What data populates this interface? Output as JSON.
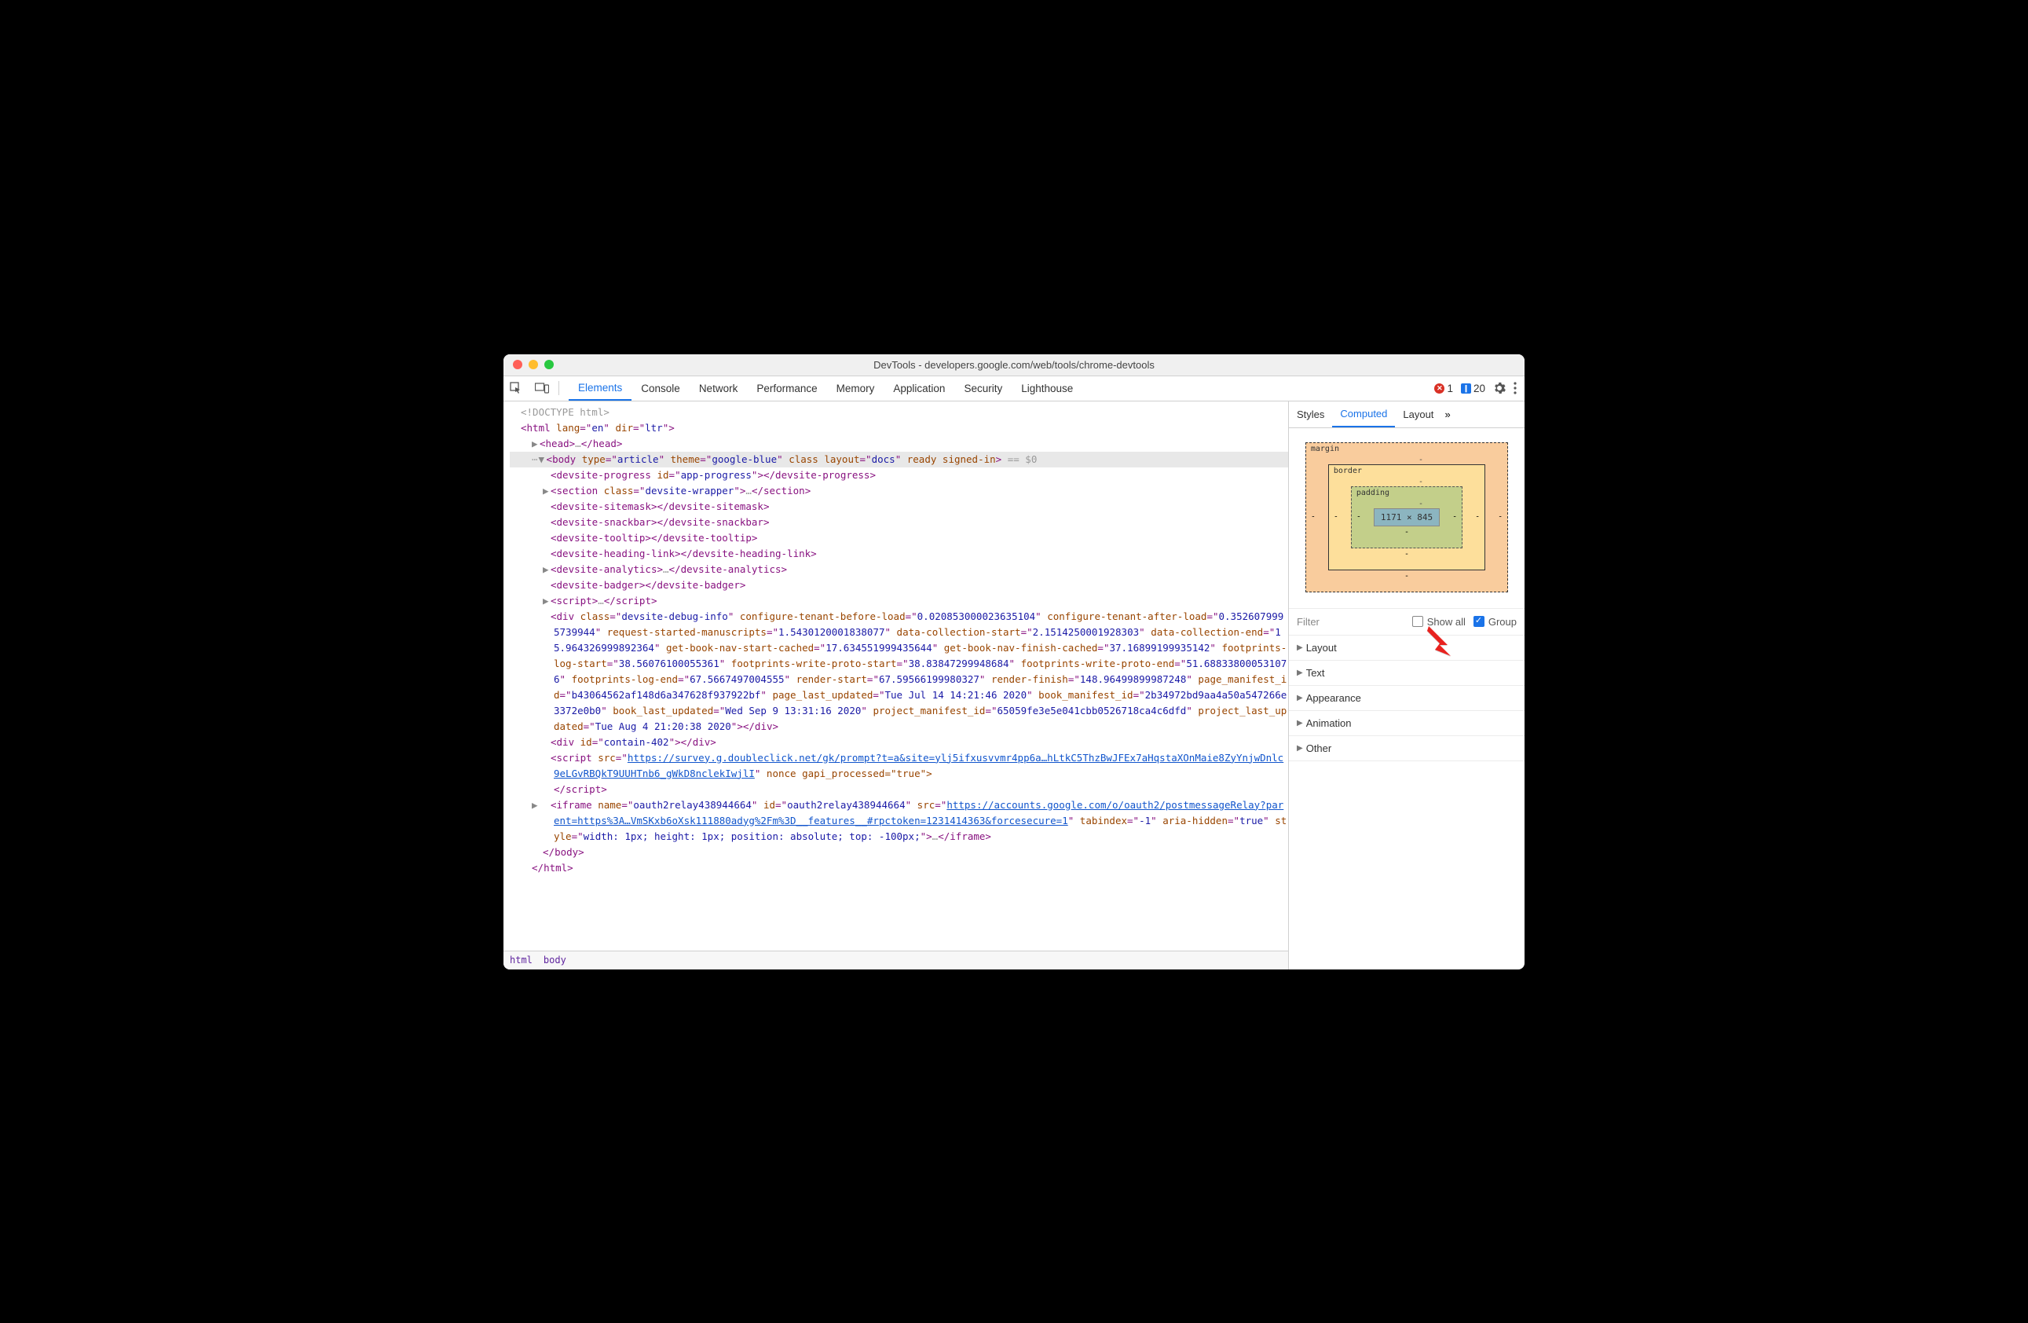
{
  "window": {
    "title": "DevTools - developers.google.com/web/tools/chrome-devtools"
  },
  "toolbar": {
    "tabs": [
      "Elements",
      "Console",
      "Network",
      "Performance",
      "Memory",
      "Application",
      "Security",
      "Lighthouse"
    ],
    "active_tab": "Elements",
    "error_count": "1",
    "message_count": "20"
  },
  "dom": {
    "doctype": "<!DOCTYPE html>",
    "html_open": {
      "tag": "html",
      "attrs": [
        [
          "lang",
          "en"
        ],
        [
          "dir",
          "ltr"
        ]
      ]
    },
    "head": {
      "tag": "head",
      "ellipsis": "…"
    },
    "body_open": {
      "tag": "body",
      "attrs": [
        [
          "type",
          "article"
        ],
        [
          "theme",
          "google-blue"
        ]
      ],
      "bare": [
        "class",
        "ready",
        "signed-in"
      ],
      "layout": [
        "layout",
        "docs"
      ],
      "trail": " == $0"
    },
    "children": [
      {
        "open": "<devsite-progress id=\"app-progress\">",
        "close": "</devsite-progress>"
      },
      {
        "arrow": true,
        "open": "<section class=\"devsite-wrapper\">",
        "mid": "…",
        "close": "</section>"
      },
      {
        "open": "<devsite-sitemask>",
        "close": "</devsite-sitemask>"
      },
      {
        "open": "<devsite-snackbar>",
        "close": "</devsite-snackbar>"
      },
      {
        "open": "<devsite-tooltip>",
        "close": "</devsite-tooltip>"
      },
      {
        "open": "<devsite-heading-link>",
        "close": "</devsite-heading-link>"
      },
      {
        "arrow": true,
        "open": "<devsite-analytics>",
        "mid": "…",
        "close": "</devsite-analytics>"
      },
      {
        "open": "<devsite-badger>",
        "close": "</devsite-badger>"
      },
      {
        "arrow": true,
        "open": "<script>",
        "mid": "…",
        "close": "</script>"
      }
    ],
    "debug_div": {
      "class": "devsite-debug-info",
      "pairs": [
        [
          "configure-tenant-before-load",
          "0.020853000023635104"
        ],
        [
          "configure-tenant-after-load",
          "0.3526079995739944"
        ],
        [
          "request-started-manuscripts",
          "1.5430120001838077"
        ],
        [
          "data-collection-start",
          "2.1514250001928303"
        ],
        [
          "data-collection-end",
          "15.964326999892364"
        ],
        [
          "get-book-nav-start-cached",
          "17.634551999435644"
        ],
        [
          "get-book-nav-finish-cached",
          "37.16899199935142"
        ],
        [
          "footprints-log-start",
          "38.56076100055361"
        ],
        [
          "footprints-write-proto-start",
          "38.83847299948684"
        ],
        [
          "footprints-write-proto-end",
          "51.688338000531076"
        ],
        [
          "footprints-log-end",
          "67.5667497004555"
        ],
        [
          "render-start",
          "67.59566199980327"
        ],
        [
          "render-finish",
          "148.96499899987248"
        ],
        [
          "page_manifest_id",
          "b43064562af148d6a347628f937922bf"
        ],
        [
          "page_last_updated",
          "Tue Jul 14 14:21:46 2020"
        ],
        [
          "book_manifest_id",
          "2b34972bd9aa4a50a547266e3372e0b0"
        ],
        [
          "book_last_updated",
          "Wed Sep  9 13:31:16 2020"
        ],
        [
          "project_manifest_id",
          "65059fe3e5e041cbb0526718ca4c6dfd"
        ],
        [
          "project_last_updated",
          "Tue Aug  4 21:20:38 2020"
        ]
      ],
      "close": "</div>"
    },
    "contain_div": {
      "open": "<div id=\"contain-402\">",
      "close": "</div>"
    },
    "script_src": {
      "url": "https://survey.g.doubleclick.net/gk/prompt?t=a&site=ylj5ifxusvvmr4pp6a…hLtkC5ThzBwJFEx7aHqstaXOnMaie8ZyYnjwDnlc9eLGvRBQkT9UUHTnb6_gWkD8nclekIwjlI",
      "rest": " nonce gapi_processed=\"true\">",
      "close": "</script>"
    },
    "iframe": {
      "pairs": [
        [
          "name",
          "oauth2relay438944664"
        ],
        [
          "id",
          "oauth2relay438944664"
        ]
      ],
      "src": "https://accounts.google.com/o/oauth2/postmessageRelay?parent=https%3A…VmSKxb6oXsk111880adyg%2Fm%3D__features__#rpctoken=1231414363&forcesecure=1",
      "rest_pairs": [
        [
          "tabindex",
          "-1"
        ],
        [
          "aria-hidden",
          "true"
        ],
        [
          "style",
          "width: 1px; height: 1px; position: absolute; top: -100px;"
        ]
      ],
      "mid": "…",
      "close": "</iframe>"
    },
    "body_close": "</body>",
    "html_close": "</html>"
  },
  "crumbs": [
    "html",
    "body"
  ],
  "side": {
    "tabs": [
      "Styles",
      "Computed",
      "Layout"
    ],
    "active": "Computed",
    "box": {
      "margin": "margin",
      "border": "border",
      "padding": "padding",
      "dash": "-",
      "content": "1171 × 845"
    },
    "filter_placeholder": "Filter",
    "show_all": "Show all",
    "group": "Group",
    "group_checked": true,
    "show_all_checked": false,
    "groups": [
      "Layout",
      "Text",
      "Appearance",
      "Animation",
      "Other"
    ]
  }
}
